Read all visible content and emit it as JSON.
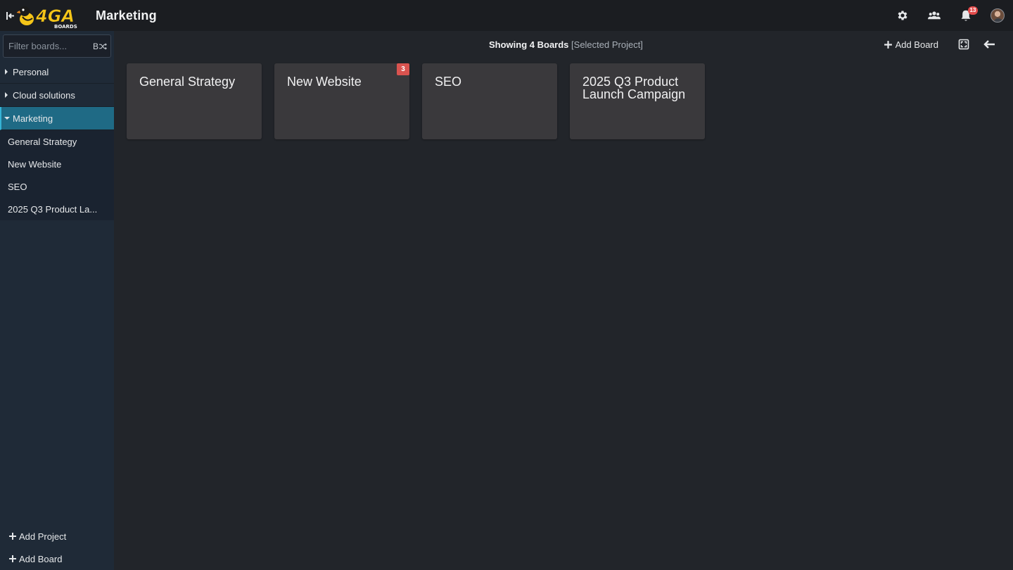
{
  "app": {
    "logo_text": "4GA",
    "logo_subtext": "BOARDS",
    "title": "Marketing"
  },
  "topbar": {
    "icons": [
      "gear-icon",
      "users-icon",
      "bell-icon",
      "avatar"
    ],
    "notification_count": "13"
  },
  "sidebar": {
    "filter": {
      "placeholder": "Filter boards...",
      "mode_label": "B"
    },
    "projects": [
      {
        "label": "Personal",
        "expanded": false
      },
      {
        "label": "Cloud solutions",
        "expanded": false
      },
      {
        "label": "Marketing",
        "expanded": true
      }
    ],
    "boards": [
      {
        "label": "General Strategy"
      },
      {
        "label": "New Website"
      },
      {
        "label": "SEO"
      },
      {
        "label": "2025 Q3 Product La..."
      }
    ],
    "footer": {
      "add_project": "Add Project",
      "add_board": "Add Board"
    }
  },
  "main": {
    "showing_bold": "Showing 4 Boards",
    "showing_scope": "[Selected Project]",
    "add_board_label": "Add Board",
    "boards": [
      {
        "title": "General Strategy",
        "badge": ""
      },
      {
        "title": "New Website",
        "badge": "3"
      },
      {
        "title": "SEO",
        "badge": ""
      },
      {
        "title": "2025 Q3 Product Launch Campaign",
        "badge": ""
      }
    ]
  },
  "colors": {
    "topbar_bg": "#1b1d21",
    "sidebar_bg": "#1f2a37",
    "active_project_bg": "#1f6a85",
    "main_bg": "#22252a",
    "card_bg": "#3a393c",
    "badge_red": "#d9534f",
    "logo_yellow": "#f5c518"
  }
}
